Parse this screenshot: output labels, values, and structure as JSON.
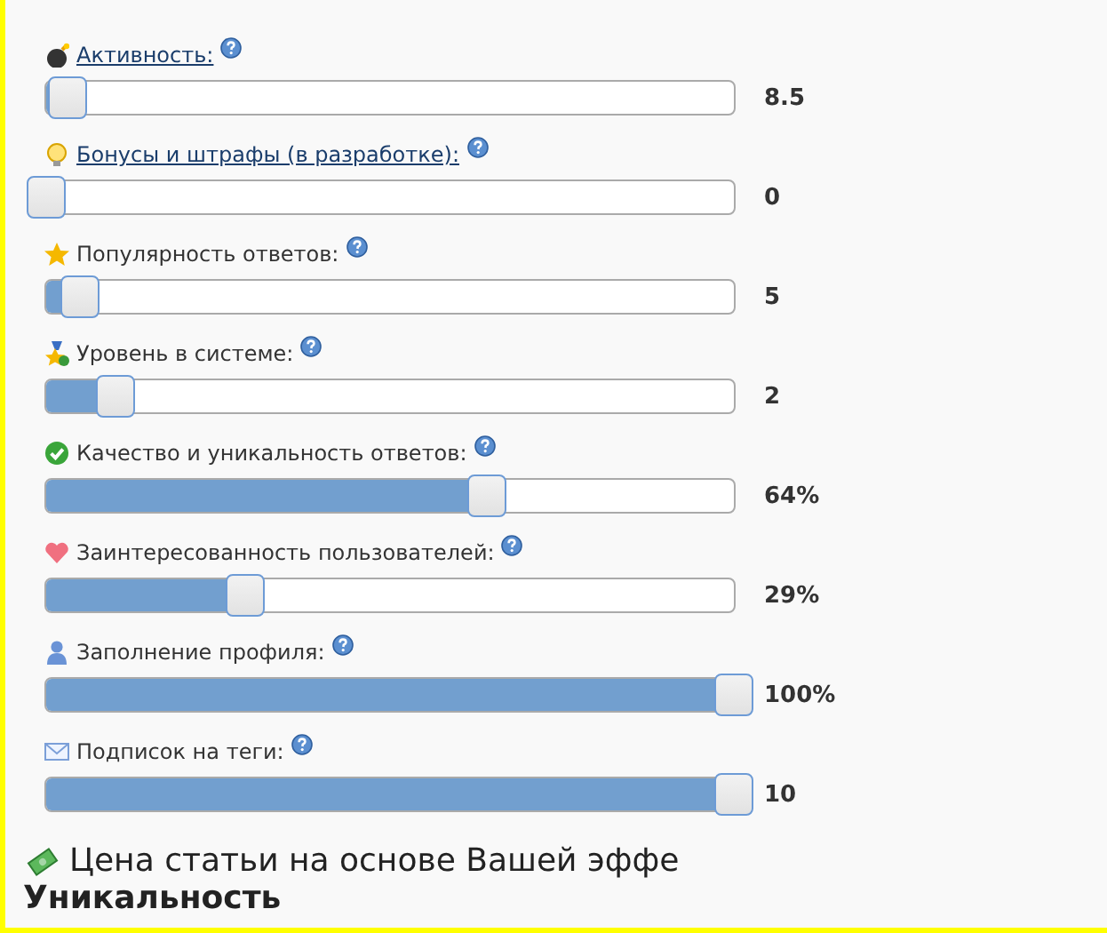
{
  "metrics": [
    {
      "label": "Активность:",
      "link": true,
      "level": 0.03,
      "reading": "8.5"
    },
    {
      "label": "Бонусы и штрафы (в разработке):",
      "link": true,
      "level": 0,
      "reading": "0"
    },
    {
      "label": "Популярность ответов:",
      "link": false,
      "level": 0.05,
      "reading": "5"
    },
    {
      "label": "Уровень в системе:",
      "link": false,
      "level": 0.1,
      "reading": "2"
    },
    {
      "label": "Качество и уникальность ответов:",
      "link": false,
      "level": 0.64,
      "reading": "64%"
    },
    {
      "label": "Заинтересованность пользователей:",
      "link": false,
      "level": 0.29,
      "reading": "29%"
    },
    {
      "label": "Заполнение профиля:",
      "link": false,
      "level": 1,
      "reading": "100%"
    },
    {
      "label": "Подписок на теги:",
      "link": false,
      "level": 1,
      "reading": "10"
    }
  ],
  "price_heading": "Цена статьи на основе Вашей эффе",
  "section_heading": "Уникальность"
}
